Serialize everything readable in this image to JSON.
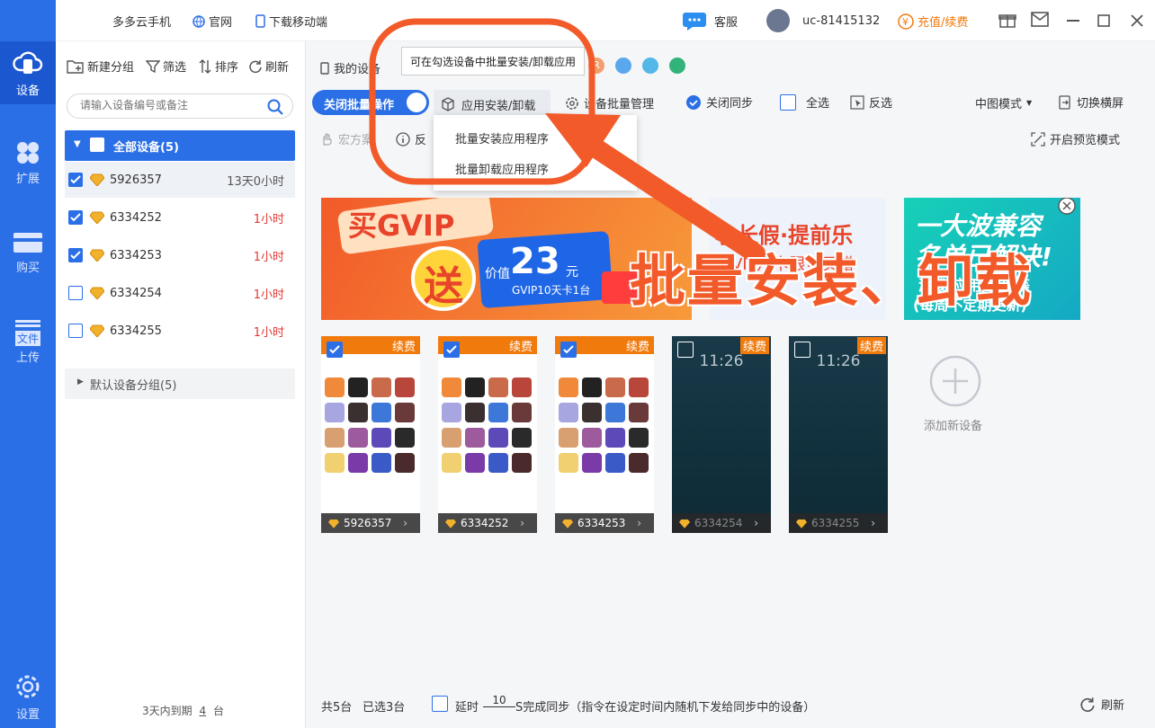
{
  "app": {
    "name": "多多云手机",
    "website": "官网",
    "download": "下载移动端",
    "service": "客服",
    "user_id": "uc-81415132",
    "recharge": "充值/续费"
  },
  "sidebar": {
    "items": [
      {
        "label": "设备",
        "icon": "cloud-phone-icon",
        "active": true
      },
      {
        "label": "扩展",
        "icon": "grid-icon"
      },
      {
        "label": "购买",
        "icon": "card-icon"
      },
      {
        "label": "上传",
        "badge": "文件",
        "icon": "upload-icon"
      },
      {
        "label": "设置",
        "icon": "gear-icon"
      }
    ]
  },
  "left_panel": {
    "tools": {
      "new_group": "新建分组",
      "filter": "筛选",
      "sort": "排序",
      "refresh": "刷新"
    },
    "search_placeholder": "请输入设备编号或备注",
    "all_devices": "全部设备(5)",
    "devices": [
      {
        "id": "5926357",
        "time": "13天0小时",
        "checked": true
      },
      {
        "id": "6334252",
        "time": "1小时",
        "checked": true
      },
      {
        "id": "6334253",
        "time": "1小时",
        "checked": true
      },
      {
        "id": "6334254",
        "time": "1小时",
        "checked": false
      },
      {
        "id": "6334255",
        "time": "1小时",
        "checked": false
      }
    ],
    "default_group": "默认设备分组(5)",
    "expire_prefix": "3天内到期",
    "expire_count": "4",
    "expire_unit": "台"
  },
  "main": {
    "my_devices": "我的设备",
    "tooltip": "可在勾选设备中批量安装/卸载应用",
    "toggle_batch": "关闭批量操作",
    "install_uninstall": "应用安装/卸载",
    "batch_manage": "设备批量管理",
    "close_sync": "关闭同步",
    "select_all": "全选",
    "invert": "反选",
    "view_mode": "中图模式",
    "switch_landscape": "切换横屏",
    "macro": "宏方案",
    "feedback": "反",
    "preview_mode": "开启预览模式",
    "dropdown": [
      "批量安装应用程序",
      "批量卸载应用程序"
    ],
    "banners": {
      "b1_line1": "买GVIP",
      "b1_gift": "送",
      "b1_price_prefix": "价值",
      "b1_price": "23",
      "b1_price_unit": "元",
      "b1_sub": "GVIP10天卡1台",
      "b2_title": "小长假·提前乐",
      "b2_sub": "GVIP月卡限量买赠",
      "b3_title1": "一大波兼容",
      "b3_title2": "名单已解决!",
      "b3_sub1": "游戏/应用/软件等",
      "b3_sub2": "(每周不定期更新)"
    },
    "phones": [
      {
        "id": "5926357",
        "renew": "续费",
        "checked": true,
        "type": "app"
      },
      {
        "id": "6334252",
        "renew": "续费",
        "checked": true,
        "type": "app"
      },
      {
        "id": "6334253",
        "renew": "续费",
        "checked": true,
        "type": "app"
      },
      {
        "id": "6334254",
        "renew": "续费",
        "checked": false,
        "type": "dark",
        "clock": "11:26"
      },
      {
        "id": "6334255",
        "renew": "续费",
        "checked": false,
        "type": "dark",
        "clock": "11:26"
      }
    ],
    "add_device": "添加新设备",
    "footer": {
      "total": "共5台",
      "selected": "已选3台",
      "delay_prefix": "延时",
      "delay_value": "10",
      "delay_suffix": "S完成同步（指令在设定时间内随机下发给同步中的设备）",
      "refresh": "刷新"
    }
  },
  "annotation": "批量安装、卸载",
  "colors": {
    "primary": "#2b6fe6",
    "accent": "#f25a2a",
    "orange": "#f17a0c",
    "red_time": "#e53935"
  }
}
